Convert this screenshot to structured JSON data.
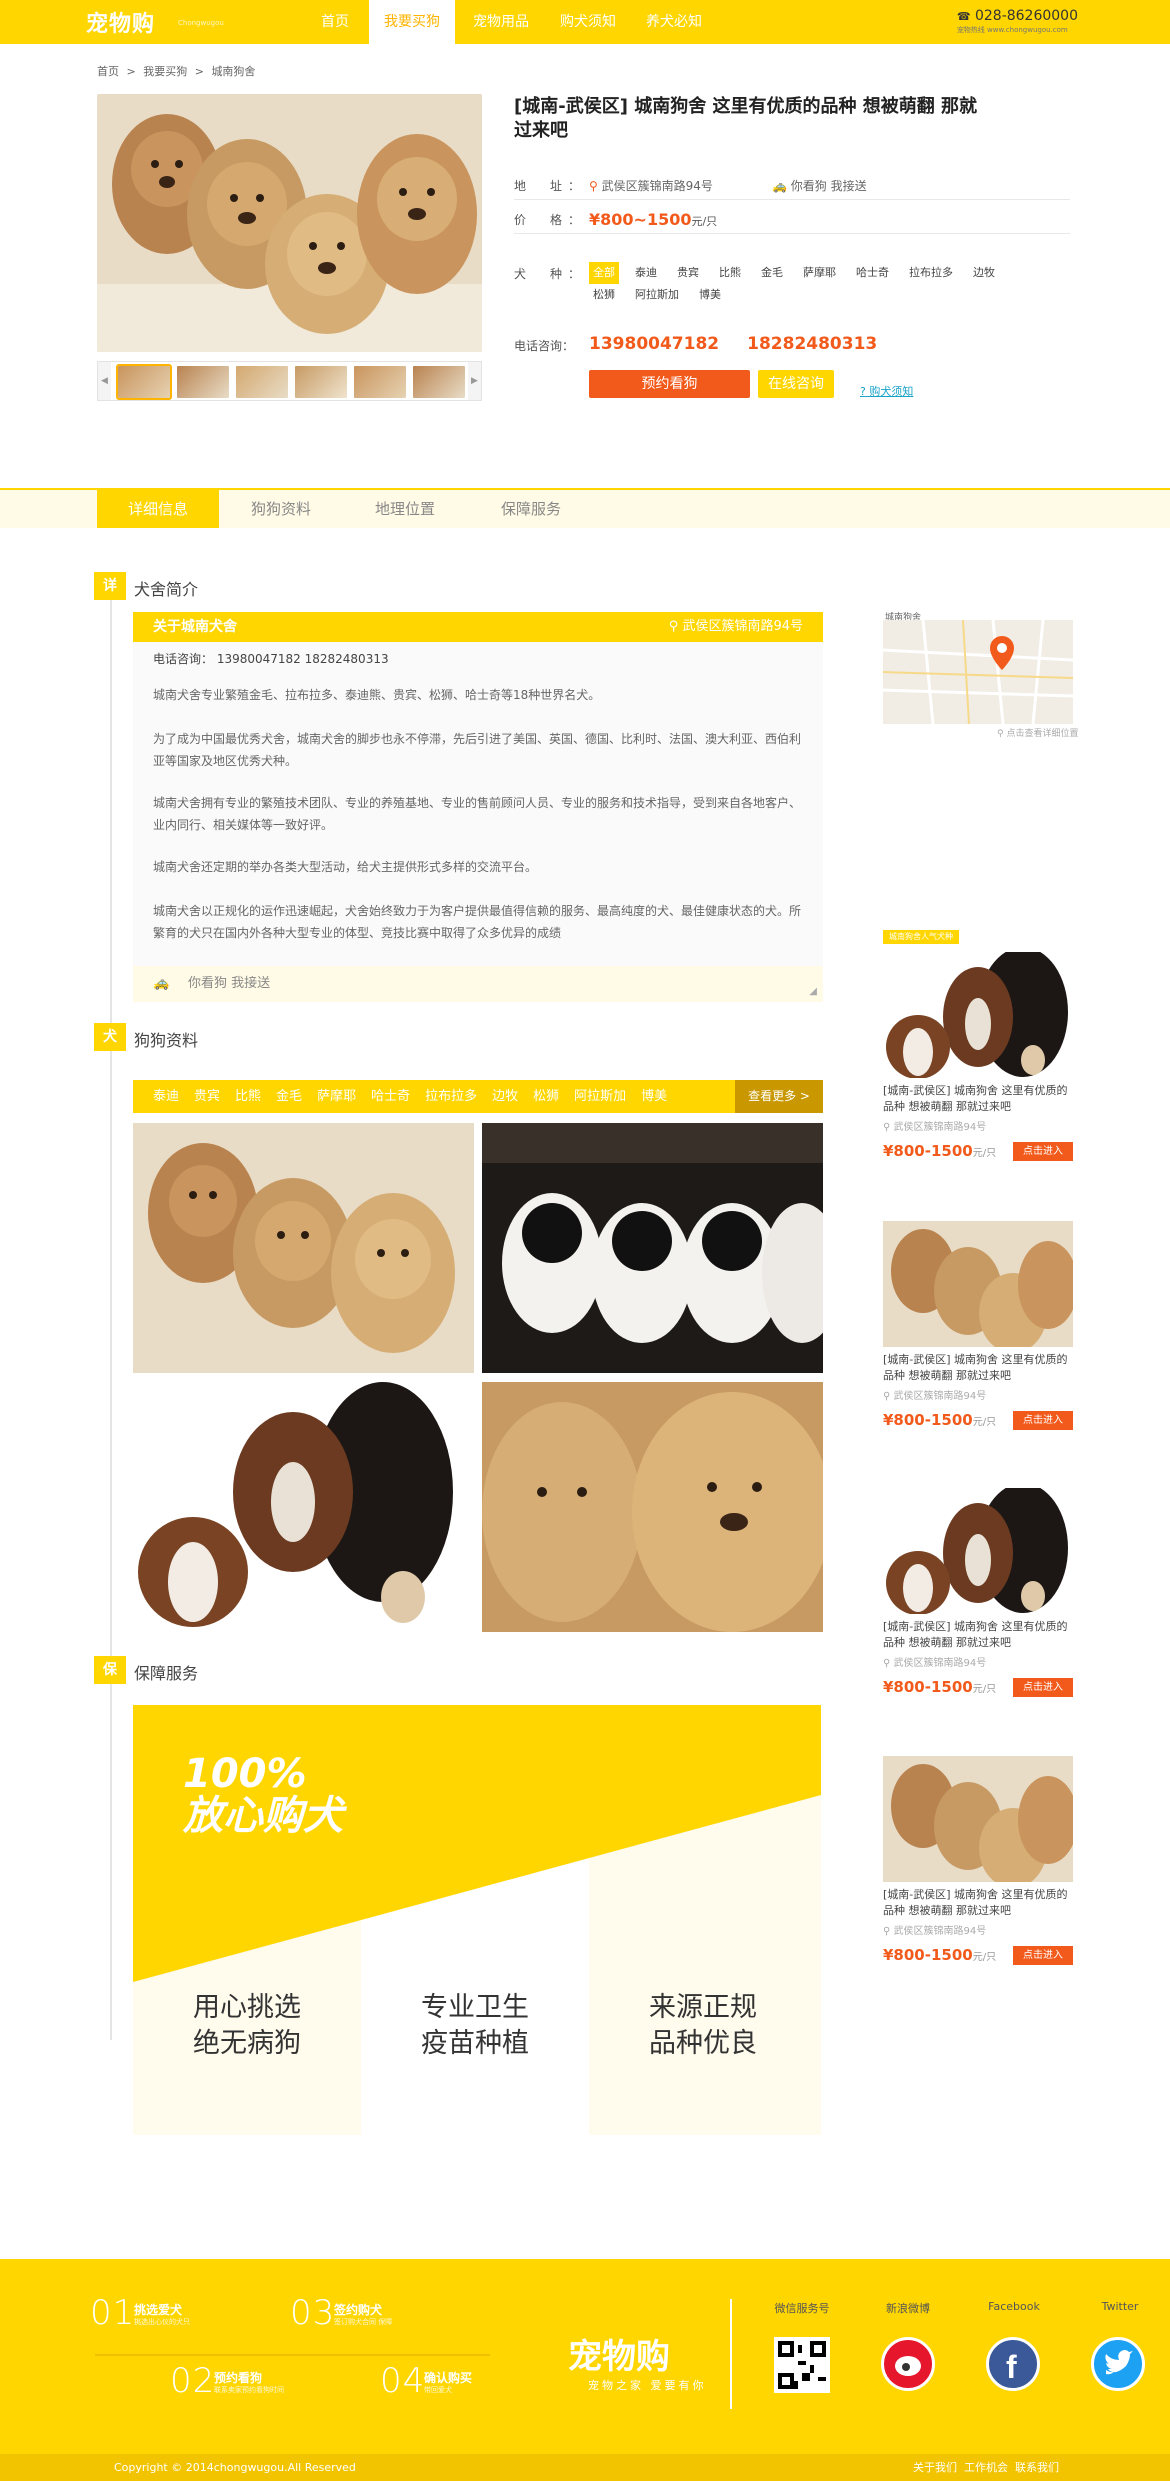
{
  "nav": {
    "logo": "宠物购",
    "logo_sub": "Chongwugou",
    "items": [
      "首页",
      "我要买狗",
      "宠物用品",
      "购犬须知",
      "养犬必知"
    ],
    "active_index": 1,
    "hotline": "028-86260000",
    "hotline_sub": "宠物热线 www.chongwugou.com"
  },
  "breadcrumb": [
    "首页",
    ">",
    "我要买狗",
    ">",
    "城南狗舍"
  ],
  "product": {
    "title": "[城南-武侯区] 城南狗舍 这里有优质的品种 想被萌翻 那就过来吧",
    "address_label": "地　址：",
    "address": "武侯区簇锦南路94号",
    "pickup": "你看狗 我接送",
    "price_label": "价　格：",
    "price": "¥800~1500",
    "price_unit": "元/只",
    "breed_label": "犬　种：",
    "breeds": [
      "全部",
      "泰迪",
      "贵宾",
      "比熊",
      "金毛",
      "萨摩耶",
      "哈士奇",
      "拉布拉多",
      "边牧",
      "松狮",
      "阿拉斯加",
      "博美"
    ],
    "phone_label": "电话咨询：",
    "phone1": "13980047182",
    "phone2": "18282480313",
    "btn_book": "预约看狗",
    "btn_chat": "在线咨询",
    "link_notice": "购犬须知"
  },
  "tabs": [
    "详细信息",
    "狗狗资料",
    "地理位置",
    "保障服务"
  ],
  "section1": {
    "badge": "详",
    "title": "犬舍简介",
    "bar_title": "关于城南犬舍",
    "bar_addr": "武侯区簇锦南路94号",
    "phone_line": "电话咨询：  13980047182    18282480313",
    "paragraphs": [
      "城南犬舍专业繁殖金毛、拉布拉多、泰迪熊、贵宾、松狮、哈士奇等18种世界名犬。",
      "为了成为中国最优秀犬舍，城南犬舍的脚步也永不停滞，先后引进了美国、英国、德国、比利时、法国、澳大利亚、西伯利亚等国家及地区优秀犬种。",
      "城南犬舍拥有专业的繁殖技术团队、专业的养殖基地、专业的售前顾问人员、专业的服务和技术指导，受到来自各地客户、业内同行、相关媒体等一致好评。",
      "城南犬舍还定期的举办各类大型活动，给犬主提供形式多样的交流平台。",
      "城南犬舍以正规化的运作迅速崛起，犬舍始终致力于为客户提供最值得信赖的服务、最高纯度的犬、最佳健康状态的犬。所繁育的犬只在国内外各种大型专业的体型、竞技比赛中取得了众多优异的成绩"
    ],
    "visit": "你看狗 我接送"
  },
  "section2": {
    "badge": "犬",
    "title": "狗狗资料",
    "breeds": [
      "泰迪",
      "贵宾",
      "比熊",
      "金毛",
      "萨摩耶",
      "哈士奇",
      "拉布拉多",
      "边牧",
      "松狮",
      "阿拉斯加",
      "博美"
    ],
    "more": "查看更多 >"
  },
  "section3": {
    "badge": "保",
    "title": "保障服务",
    "headline1": "100%",
    "headline2": "放心购犬",
    "cols": [
      {
        "l1": "用心挑选",
        "l2": "绝无病狗"
      },
      {
        "l1": "专业卫生",
        "l2": "疫苗种植"
      },
      {
        "l1": "来源正规",
        "l2": "品种优良"
      }
    ]
  },
  "sidebar": {
    "map_title": "城南狗舍",
    "map_link": "点击查看详细位置",
    "hot_tag": "城南狗舍人气犬种",
    "recs": [
      {
        "title": "[城南-武侯区] 城南狗舍 这里有优质的品种 想被萌翻 那就过来吧",
        "addr": "武侯区簇锦南路94号",
        "price": "¥800-1500",
        "unit": "元/只",
        "btn": "点击进入"
      },
      {
        "title": "[城南-武侯区] 城南狗舍 这里有优质的品种 想被萌翻 那就过来吧",
        "addr": "武侯区簇锦南路94号",
        "price": "¥800-1500",
        "unit": "元/只",
        "btn": "点击进入"
      },
      {
        "title": "[城南-武侯区] 城南狗舍 这里有优质的品种 想被萌翻 那就过来吧",
        "addr": "武侯区簇锦南路94号",
        "price": "¥800-1500",
        "unit": "元/只",
        "btn": "点击进入"
      },
      {
        "title": "[城南-武侯区] 城南狗舍 这里有优质的品种 想被萌翻 那就过来吧",
        "addr": "武侯区簇锦南路94号",
        "price": "¥800-1500",
        "unit": "元/只",
        "btn": "点击进入"
      }
    ]
  },
  "footer": {
    "steps": [
      {
        "n": "01",
        "t": "挑选爱犬",
        "s": "挑选出心仪的犬只"
      },
      {
        "n": "02",
        "t": "预约看狗",
        "s": "联系卖家预约看狗时间"
      },
      {
        "n": "03",
        "t": "签约购犬",
        "s": "签订购犬合同 保障"
      },
      {
        "n": "04",
        "t": "确认购买",
        "s": "带回爱犬"
      }
    ],
    "logo": "宠物购",
    "slogan": "宠物之家 爱要有你",
    "social": [
      "微信服务号",
      "新浪微博",
      "Facebook",
      "Twitter"
    ],
    "copyright": "Copyright © 2014chongwugou.All Reserved",
    "links": [
      "关于我们",
      "工作机会",
      "联系我们"
    ]
  },
  "colors": {
    "brand": "#ffd600",
    "accent": "#f25a1b",
    "link": "#19a3c9"
  }
}
